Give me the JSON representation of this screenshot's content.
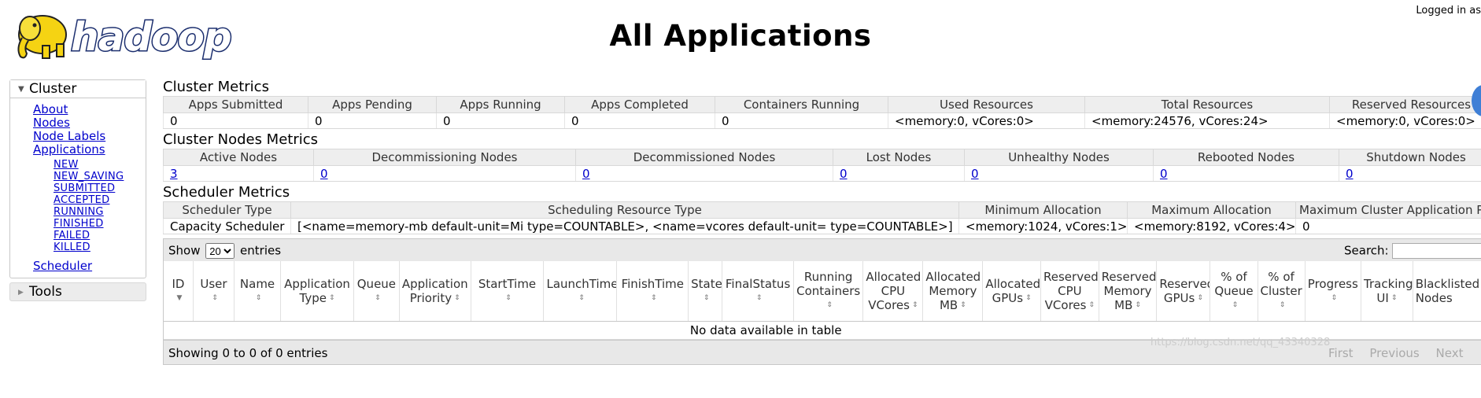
{
  "header": {
    "logo_text": "hadoop",
    "title": "All Applications",
    "logged_in": "Logged in as"
  },
  "sidebar": {
    "cluster_label": "Cluster",
    "links": [
      "About",
      "Nodes",
      "Node Labels",
      "Applications"
    ],
    "states": [
      "NEW",
      "NEW_SAVING",
      "SUBMITTED",
      "ACCEPTED",
      "RUNNING",
      "FINISHED",
      "FAILED",
      "KILLED"
    ],
    "scheduler_label": "Scheduler",
    "tools_label": "Tools"
  },
  "cluster_metrics": {
    "title": "Cluster Metrics",
    "headers": [
      "Apps Submitted",
      "Apps Pending",
      "Apps Running",
      "Apps Completed",
      "Containers Running",
      "Used Resources",
      "Total Resources",
      "Reserved Resources"
    ],
    "values": [
      "0",
      "0",
      "0",
      "0",
      "0",
      "<memory:0, vCores:0>",
      "<memory:24576, vCores:24>",
      "<memory:0, vCores:0>"
    ]
  },
  "nodes_metrics": {
    "title": "Cluster Nodes Metrics",
    "headers": [
      "Active Nodes",
      "Decommissioning Nodes",
      "Decommissioned Nodes",
      "Lost Nodes",
      "Unhealthy Nodes",
      "Rebooted Nodes",
      "Shutdown Nodes"
    ],
    "values": [
      "3",
      "0",
      "0",
      "0",
      "0",
      "0",
      "0"
    ]
  },
  "scheduler_metrics": {
    "title": "Scheduler Metrics",
    "headers": [
      "Scheduler Type",
      "Scheduling Resource Type",
      "Minimum Allocation",
      "Maximum Allocation",
      "Maximum Cluster Application Priority"
    ],
    "values": [
      "Capacity Scheduler",
      "[<name=memory-mb default-unit=Mi type=COUNTABLE>, <name=vcores default-unit= type=COUNTABLE>]",
      "<memory:1024, vCores:1>",
      "<memory:8192, vCores:4>",
      "0"
    ]
  },
  "apps_table": {
    "show_label": "Show",
    "entries_label": "entries",
    "page_size": "20",
    "search_label": "Search:",
    "columns": [
      "ID",
      "User",
      "Name",
      "Application Type",
      "Queue",
      "Application Priority",
      "StartTime",
      "LaunchTime",
      "FinishTime",
      "State",
      "FinalStatus",
      "Running Containers",
      "Allocated CPU VCores",
      "Allocated Memory MB",
      "Allocated GPUs",
      "Reserved CPU VCores",
      "Reserved Memory MB",
      "Reserved GPUs",
      "% of Queue",
      "% of Cluster",
      "Progress",
      "Tracking UI",
      "Blacklisted Nodes"
    ],
    "empty_message": "No data available in table",
    "info": "Showing 0 to 0 of 0 entries",
    "pagination": [
      "First",
      "Previous",
      "Next"
    ]
  },
  "watermark": "https://blog.csdn.net/qq_43340328",
  "icons": {
    "expand": "triangle-down",
    "collapse": "triangle-right",
    "sort": "up-down-arrows"
  }
}
